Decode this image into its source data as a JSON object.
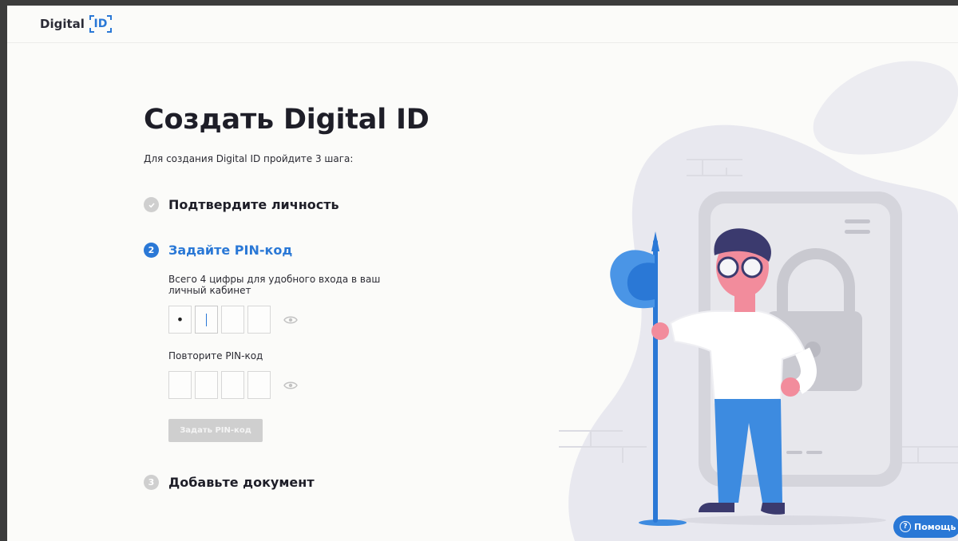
{
  "header": {
    "logo_text": "Digital",
    "logo_id": "ID"
  },
  "main": {
    "title": "Создать Digital ID",
    "subtitle": "Для создания Digital ID пройдите 3 шага:",
    "steps": [
      {
        "number": "",
        "label": "Подтвердите личность",
        "state": "done",
        "icon": "check-icon"
      },
      {
        "number": "2",
        "label": "Задайте PIN-код",
        "state": "active"
      },
      {
        "number": "3",
        "label": "Добавьте документ",
        "state": "pending"
      }
    ],
    "pin": {
      "description": "Всего 4 цифры для удобного входа в ваш личный кабинет",
      "first_digit": "•",
      "repeat_label": "Повторите PIN-код",
      "submit_label": "Задать PIN-код",
      "show_icon": "eye-icon"
    }
  },
  "help": {
    "icon": "question-icon",
    "label": "Помощь"
  },
  "colors": {
    "accent": "#2a78d6",
    "disabled": "#cfcfcf",
    "illustration_shirt": "#ffffff",
    "illustration_pants": "#3d8be0"
  }
}
